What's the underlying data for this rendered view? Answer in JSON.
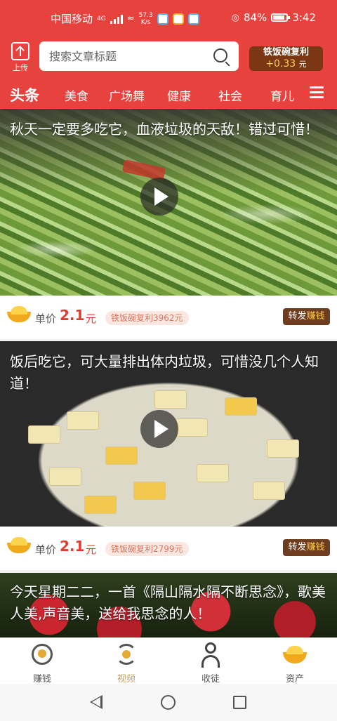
{
  "status_bar": {
    "carrier": "中国移动",
    "network": "4G",
    "speed_value": "57.3",
    "speed_unit": "K/s",
    "battery": "84%",
    "time": "3:42"
  },
  "header": {
    "upload_label": "上传",
    "search_placeholder": "搜索文章标题",
    "bonus_title": "铁饭碗复利",
    "bonus_value": "+0.33",
    "bonus_unit": "元"
  },
  "tabs": [
    "头条",
    "美食",
    "广场舞",
    "健康",
    "社会",
    "育儿"
  ],
  "feed": [
    {
      "title": "秋天一定要多吃它，血液垃圾的天敌！错过可惜！",
      "price_label": "单价",
      "price": "2.1",
      "unit": "元",
      "bonus_pill": "铁饭碗复利3962元",
      "share_a": "转发",
      "share_b": "赚钱"
    },
    {
      "title": "饭后吃它，可大量排出体内垃圾，可惜没几个人知道！",
      "price_label": "单价",
      "price": "2.1",
      "unit": "元",
      "bonus_pill": "铁饭碗复利2799元",
      "share_a": "转发",
      "share_b": "赚钱"
    },
    {
      "title": "今天星期二二，一首《隔山隔水隔不断思念》，歌美人美,声音美，送给我思念的人！"
    }
  ],
  "bottom_nav": [
    {
      "label": "赚钱",
      "icon": "earn-icon"
    },
    {
      "label": "视频",
      "icon": "video-refresh-icon",
      "active": true
    },
    {
      "label": "收徒",
      "icon": "disciple-icon"
    },
    {
      "label": "资产",
      "icon": "asset-icon"
    }
  ],
  "colors": {
    "brand_red": "#e8423f",
    "price_red": "#e03c30",
    "active_nav": "#c8a45a",
    "share_brown": "#6e3d20"
  }
}
